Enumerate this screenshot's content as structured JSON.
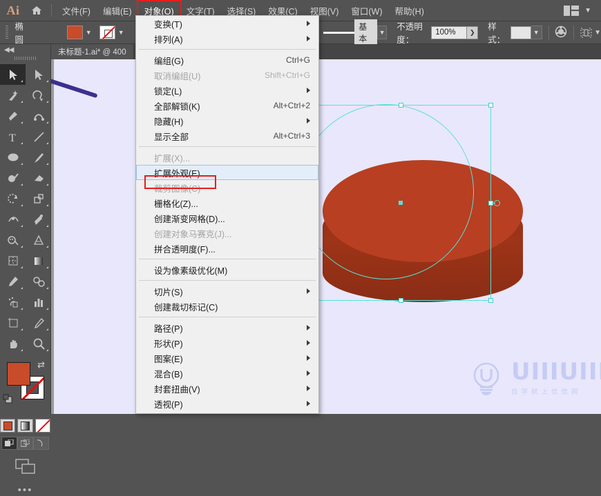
{
  "app": {
    "logo": "Ai",
    "home_icon": "home-icon",
    "workspace_icon": "workspace-layout-icon",
    "workspace_chevron": "chevron-down-icon"
  },
  "menubar": {
    "items": [
      {
        "label": "文件(F)",
        "active": false
      },
      {
        "label": "编辑(E)",
        "active": false
      },
      {
        "label": "对象(O)",
        "active": true
      },
      {
        "label": "文字(T)",
        "active": false
      },
      {
        "label": "选择(S)",
        "active": false
      },
      {
        "label": "效果(C)",
        "active": false
      },
      {
        "label": "视图(V)",
        "active": false
      },
      {
        "label": "窗口(W)",
        "active": false
      },
      {
        "label": "帮助(H)",
        "active": false
      }
    ]
  },
  "controlbar": {
    "object_label": "椭圆",
    "fill_color": "#c84b2a",
    "fill_dropdown": "chevron-down-icon",
    "stroke_swatch": "none-swatch",
    "stroke_dropdown": "chevron-down-icon",
    "stroke_profile_label": "基本",
    "stroke_profile_dropdown": "chevron-down-icon",
    "opacity_label": "不透明度：",
    "opacity_value": "100%",
    "opacity_stepper": "chevron-right-icon",
    "style_label": "样式：",
    "style_swatch_color": "#e6e6e6",
    "style_dropdown": "chevron-down-icon",
    "recolor_icon": "recolor-artwork-icon",
    "align_icon": "align-icon",
    "align_dropdown": "chevron-down-icon"
  },
  "document": {
    "tab_title": "未标题-1.ai* @ 400"
  },
  "toolbar": {
    "collapse_icon": "collapse-panel-icon",
    "grip_icon": "drag-grip-icon",
    "tools": [
      {
        "name": "selection-tool",
        "selected": true
      },
      {
        "name": "direct-selection-tool",
        "selected": false
      },
      {
        "name": "magic-wand-tool",
        "selected": false
      },
      {
        "name": "lasso-tool",
        "selected": false
      },
      {
        "name": "pen-tool",
        "selected": false
      },
      {
        "name": "curvature-tool",
        "selected": false
      },
      {
        "name": "type-tool",
        "selected": false
      },
      {
        "name": "line-segment-tool",
        "selected": false
      },
      {
        "name": "ellipse-tool",
        "selected": false
      },
      {
        "name": "paintbrush-tool",
        "selected": false
      },
      {
        "name": "shaper-tool",
        "selected": false
      },
      {
        "name": "eraser-tool",
        "selected": false
      },
      {
        "name": "rotate-tool",
        "selected": false
      },
      {
        "name": "scale-tool",
        "selected": false
      },
      {
        "name": "width-tool",
        "selected": false
      },
      {
        "name": "free-transform-tool",
        "selected": false
      },
      {
        "name": "shape-builder-tool",
        "selected": false
      },
      {
        "name": "perspective-grid-tool",
        "selected": false
      },
      {
        "name": "mesh-tool",
        "selected": false
      },
      {
        "name": "gradient-tool",
        "selected": false
      },
      {
        "name": "eyedropper-tool",
        "selected": false
      },
      {
        "name": "blend-tool",
        "selected": false
      },
      {
        "name": "symbol-sprayer-tool",
        "selected": false
      },
      {
        "name": "column-graph-tool",
        "selected": false
      },
      {
        "name": "artboard-tool",
        "selected": false
      },
      {
        "name": "slice-tool",
        "selected": false
      },
      {
        "name": "hand-tool",
        "selected": false
      },
      {
        "name": "zoom-tool",
        "selected": false
      }
    ],
    "fill_color": "#c84b2a",
    "stroke_color": "#ffffff",
    "stroke_none": true,
    "swap_icon": "swap-fill-stroke-icon",
    "default_icon": "default-fill-stroke-icon",
    "color_modes": [
      "color-swatch-mode",
      "gradient-mode",
      "none-mode"
    ],
    "draw_modes": [
      "draw-normal",
      "draw-behind",
      "draw-inside"
    ],
    "screen_mode_icon": "change-screen-mode-icon",
    "more_tools_icon": "more-tools-icon"
  },
  "menu": {
    "title": "对象(O)",
    "groups": [
      {
        "items": [
          {
            "label": "变换(T)",
            "shortcut": "",
            "submenu": true,
            "disabled": false,
            "highlighted": false
          },
          {
            "label": "排列(A)",
            "shortcut": "",
            "submenu": true,
            "disabled": false,
            "highlighted": false
          }
        ]
      },
      {
        "items": [
          {
            "label": "编组(G)",
            "shortcut": "Ctrl+G",
            "submenu": false,
            "disabled": false,
            "highlighted": false
          },
          {
            "label": "取消编组(U)",
            "shortcut": "Shift+Ctrl+G",
            "submenu": false,
            "disabled": true,
            "highlighted": false
          },
          {
            "label": "锁定(L)",
            "shortcut": "",
            "submenu": true,
            "disabled": false,
            "highlighted": false
          },
          {
            "label": "全部解锁(K)",
            "shortcut": "Alt+Ctrl+2",
            "submenu": false,
            "disabled": false,
            "highlighted": false
          },
          {
            "label": "隐藏(H)",
            "shortcut": "",
            "submenu": true,
            "disabled": false,
            "highlighted": false
          },
          {
            "label": "显示全部",
            "shortcut": "Alt+Ctrl+3",
            "submenu": false,
            "disabled": false,
            "highlighted": false
          }
        ]
      },
      {
        "items": [
          {
            "label": "扩展(X)...",
            "shortcut": "",
            "submenu": false,
            "disabled": true,
            "highlighted": false
          },
          {
            "label": "扩展外观(E)",
            "shortcut": "",
            "submenu": false,
            "disabled": false,
            "highlighted": true
          },
          {
            "label": "裁剪图像(C)",
            "shortcut": "",
            "submenu": false,
            "disabled": true,
            "highlighted": false
          },
          {
            "label": "栅格化(Z)...",
            "shortcut": "",
            "submenu": false,
            "disabled": false,
            "highlighted": false
          },
          {
            "label": "创建渐变网格(D)...",
            "shortcut": "",
            "submenu": false,
            "disabled": false,
            "highlighted": false
          },
          {
            "label": "创建对象马赛克(J)...",
            "shortcut": "",
            "submenu": false,
            "disabled": true,
            "highlighted": false
          },
          {
            "label": "拼合透明度(F)...",
            "shortcut": "",
            "submenu": false,
            "disabled": false,
            "highlighted": false
          }
        ]
      },
      {
        "items": [
          {
            "label": "设为像素级优化(M)",
            "shortcut": "",
            "submenu": false,
            "disabled": false,
            "highlighted": false
          }
        ]
      },
      {
        "items": [
          {
            "label": "切片(S)",
            "shortcut": "",
            "submenu": true,
            "disabled": false,
            "highlighted": false
          },
          {
            "label": "创建裁切标记(C)",
            "shortcut": "",
            "submenu": false,
            "disabled": false,
            "highlighted": false
          }
        ]
      },
      {
        "items": [
          {
            "label": "路径(P)",
            "shortcut": "",
            "submenu": true,
            "disabled": false,
            "highlighted": false
          },
          {
            "label": "形状(P)",
            "shortcut": "",
            "submenu": true,
            "disabled": false,
            "highlighted": false
          },
          {
            "label": "图案(E)",
            "shortcut": "",
            "submenu": true,
            "disabled": false,
            "highlighted": false
          },
          {
            "label": "混合(B)",
            "shortcut": "",
            "submenu": true,
            "disabled": false,
            "highlighted": false
          },
          {
            "label": "封套扭曲(V)",
            "shortcut": "",
            "submenu": true,
            "disabled": false,
            "highlighted": false
          },
          {
            "label": "透视(P)",
            "shortcut": "",
            "submenu": true,
            "disabled": false,
            "highlighted": false
          }
        ]
      }
    ]
  },
  "artwork": {
    "shape": "3d-extruded-ellipse",
    "top_face_color": "#b83f22",
    "side_face_color": "#9e3418",
    "selection_color": "#4fe3da",
    "canvas_background": "#E9E7FB"
  },
  "watermark": {
    "logo_icon": "lightbulb-u-logo-icon",
    "text": "UIIIUIII",
    "subtitle": "自学就上优优网",
    "color": "#a9b6ef"
  }
}
